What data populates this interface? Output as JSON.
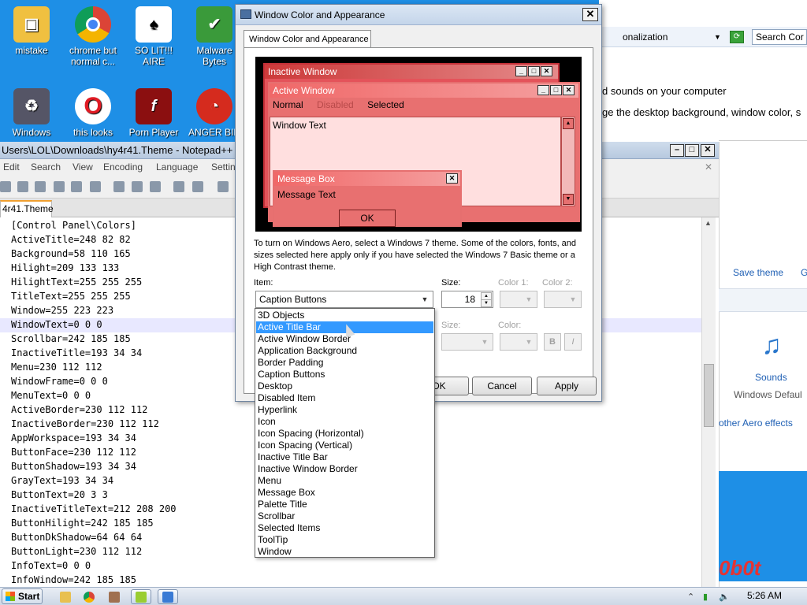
{
  "desktop": {
    "icons": [
      {
        "label": "mistake",
        "icon": "image-folder-icon"
      },
      {
        "label": "chrome but normal c...",
        "icon": "chrome-icon"
      },
      {
        "label": "SO LIT!!! AIRE",
        "icon": "solitaire-icon"
      },
      {
        "label": "Malware Bytes",
        "icon": "shield-icon"
      },
      {
        "label": "Windows",
        "icon": "recycle-bin-icon"
      },
      {
        "label": "this looks",
        "icon": "opera-icon"
      },
      {
        "label": "Porn Player",
        "icon": "flash-icon"
      },
      {
        "label": "ANGER BIR",
        "icon": "angry-bird-icon"
      }
    ]
  },
  "personalization": {
    "address_text": "onalization",
    "search_placeholder": "Search Cor",
    "line1": "d sounds on your computer",
    "line2": "ge the desktop background, window color, s",
    "save_theme": "Save theme",
    "g_link": "G",
    "sounds_label": "Sounds",
    "sounds_sub": "Windows Defaul",
    "aero_link": "other Aero effects",
    "logo_text": "0b0t"
  },
  "notepad": {
    "title": "Users\\LOL\\Downloads\\hy4r41.Theme - Notepad++",
    "menu": [
      "Edit",
      "Search",
      "View",
      "Encoding",
      "Language",
      "Settin"
    ],
    "tab": "4r41.Theme",
    "lines": [
      "[Control Panel\\Colors]",
      "ActiveTitle=248 82 82",
      "Background=58 110 165",
      "Hilight=209 133 133",
      "HilightText=255 255 255",
      "TitleText=255 255 255",
      "Window=255 223 223",
      "WindowText=0 0 0",
      "Scrollbar=242 185 185",
      "InactiveTitle=193 34 34",
      "Menu=230 112 112",
      "WindowFrame=0 0 0",
      "MenuText=0 0 0",
      "ActiveBorder=230 112 112",
      "InactiveBorder=230 112 112",
      "AppWorkspace=193 34 34",
      "ButtonFace=230 112 112",
      "ButtonShadow=193 34 34",
      "GrayText=193 34 34",
      "ButtonText=20 3 3",
      "InactiveTitleText=212 208 200",
      "ButtonHilight=242 185 185",
      "ButtonDkShadow=64 64 64",
      "ButtonLight=230 112 112",
      "InfoText=0 0 0",
      "InfoWindow=242 185 185"
    ],
    "highlighted_line": 7
  },
  "dialog": {
    "title": "Window Color and Appearance",
    "tab": "Window Color and Appearance",
    "preview": {
      "inactive_title": "Inactive Window",
      "active_title": "Active Window",
      "menu": [
        "Normal",
        "Disabled",
        "Selected"
      ],
      "window_text": "Window Text",
      "message_title": "Message Box",
      "message_text": "Message Text",
      "ok": "OK"
    },
    "description": "To turn on Windows Aero, select a Windows 7 theme.  Some of the colors, fonts, and sizes selected here apply only if you have selected the Windows 7 Basic theme or a High Contrast theme.",
    "item_label": "Item:",
    "item_value": "Caption Buttons",
    "size_label": "Size:",
    "size_value": "18",
    "color1_label": "Color 1:",
    "color2_label": "Color 2:",
    "font_size_label": "Size:",
    "color_label": "Color:",
    "bold": "B",
    "italic": "I",
    "ok": "OK",
    "cancel": "Cancel",
    "apply": "Apply",
    "options": [
      "3D Objects",
      "Active Title Bar",
      "Active Window Border",
      "Application Background",
      "Border Padding",
      "Caption Buttons",
      "Desktop",
      "Disabled Item",
      "Hyperlink",
      "Icon",
      "Icon Spacing (Horizontal)",
      "Icon Spacing (Vertical)",
      "Inactive Title Bar",
      "Inactive Window Border",
      "Menu",
      "Message Box",
      "Palette Title",
      "Scrollbar",
      "Selected Items",
      "ToolTip",
      "Window"
    ],
    "selected_option": 1
  },
  "taskbar": {
    "start": "Start",
    "clock": "5:26 AM"
  },
  "colors": {
    "desktop": "#1e8fe6",
    "active_title": "#f85252",
    "selection": "#3399ff"
  }
}
